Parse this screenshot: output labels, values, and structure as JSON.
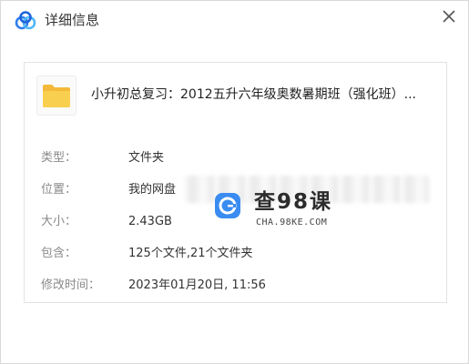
{
  "window": {
    "title": "详细信息",
    "app_icon": "baidu-netdisk-cloud-icon",
    "close_icon": "close-icon"
  },
  "file": {
    "icon": "folder-icon",
    "name": "小升初总复习：2012五升六年级奥数暑期班（强化班）..."
  },
  "details": {
    "type_label": "类型：",
    "type_value": "文件夹",
    "location_label": "位置：",
    "location_value": "我的网盘",
    "size_label": "大小：",
    "size_value": "2.43GB",
    "contains_label": "包含：",
    "contains_value": "125个文件,21个文件夹",
    "modified_label": "修改时间：",
    "modified_value": "2023年01月20日, 11:56"
  },
  "watermark": {
    "brand": "查98课",
    "url": "CHA.98KE.COM"
  },
  "colors": {
    "folder_yellow": "#f7c948",
    "logo_blue": "#3b8cf0",
    "label_gray": "#8a8a8a",
    "text_dark": "#333333"
  }
}
